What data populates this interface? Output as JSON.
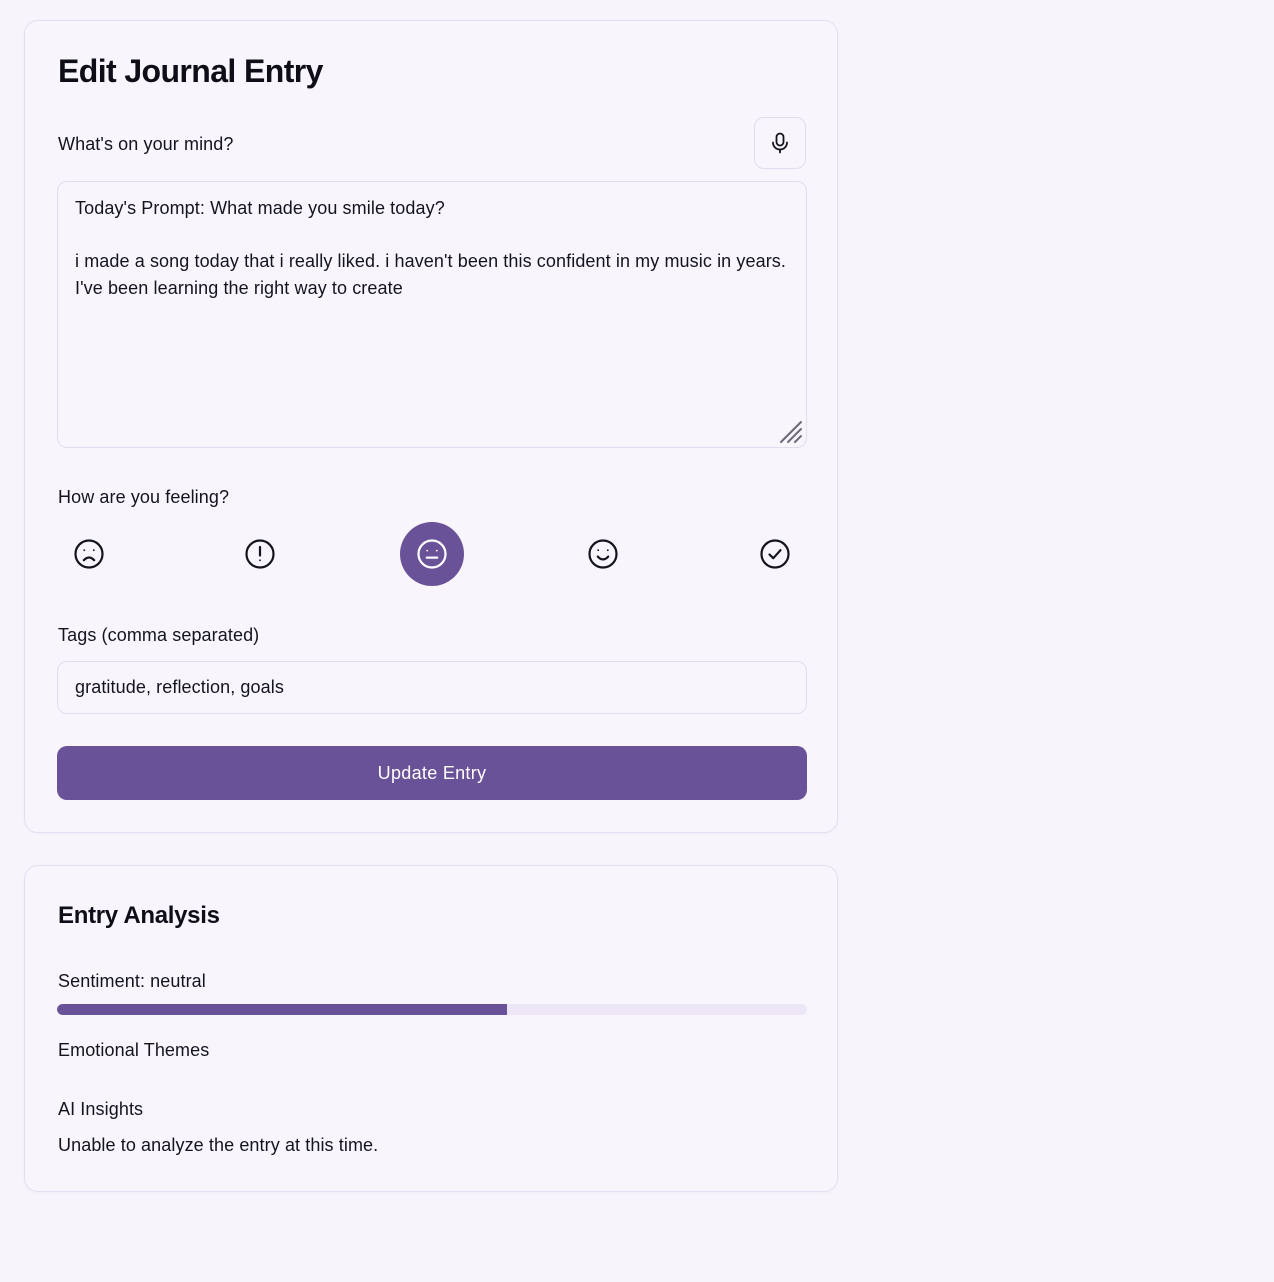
{
  "editor": {
    "title": "Edit Journal Entry",
    "entry_label": "What's on your mind?",
    "mic_icon": "microphone-icon",
    "entry_text": "Today's Prompt: What made you smile today?\n\ni made a song today that i really liked. i haven't been this confident in my music in years. I've been learning the right way to create",
    "mood_label": "How are you feeling?",
    "moods": [
      {
        "icon": "frown-icon",
        "selected": false
      },
      {
        "icon": "alert-icon",
        "selected": false
      },
      {
        "icon": "neutral-face-icon",
        "selected": true
      },
      {
        "icon": "smile-icon",
        "selected": false
      },
      {
        "icon": "check-circle-icon",
        "selected": false
      }
    ],
    "tags_label": "Tags (comma separated)",
    "tags_value": "gratitude, reflection, goals",
    "update_button": "Update Entry"
  },
  "analysis": {
    "title": "Entry Analysis",
    "sentiment_label": "Sentiment: neutral",
    "sentiment_score": 0.6,
    "themes_label": "Emotional Themes",
    "insights_label": "AI Insights",
    "insights_text": "Unable to analyze the entry at this time."
  },
  "colors": {
    "accent": "#6a5299",
    "background": "#f7f5fb",
    "card_border": "#e4def0",
    "track": "#ece6f7"
  }
}
